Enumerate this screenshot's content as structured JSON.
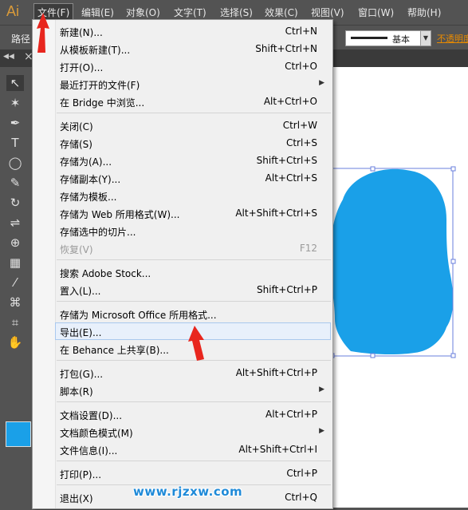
{
  "app": {
    "logo": "Ai"
  },
  "menubar": [
    "文件(F)",
    "编辑(E)",
    "对象(O)",
    "文字(T)",
    "选择(S)",
    "效果(C)",
    "视图(V)",
    "窗口(W)",
    "帮助(H)"
  ],
  "control_bar": {
    "label": "路径",
    "stroke_profile": "基本",
    "opacity": "不透明度"
  },
  "file_menu": {
    "items": [
      {
        "label": "新建(N)...",
        "shortcut": "Ctrl+N"
      },
      {
        "label": "从模板新建(T)...",
        "shortcut": "Shift+Ctrl+N"
      },
      {
        "label": "打开(O)...",
        "shortcut": "Ctrl+O"
      },
      {
        "label": "最近打开的文件(F)",
        "shortcut": ""
      },
      {
        "label": "在 Bridge 中浏览...",
        "shortcut": "Alt+Ctrl+O"
      },
      {
        "label": "关闭(C)",
        "shortcut": "Ctrl+W"
      },
      {
        "label": "存储(S)",
        "shortcut": "Ctrl+S"
      },
      {
        "label": "存储为(A)...",
        "shortcut": "Shift+Ctrl+S"
      },
      {
        "label": "存储副本(Y)...",
        "shortcut": "Alt+Ctrl+S"
      },
      {
        "label": "存储为模板...",
        "shortcut": ""
      },
      {
        "label": "存储为 Web 所用格式(W)...",
        "shortcut": "Alt+Shift+Ctrl+S"
      },
      {
        "label": "存储选中的切片...",
        "shortcut": ""
      },
      {
        "label": "恢复(V)",
        "shortcut": "F12"
      },
      {
        "label": "搜索 Adobe Stock...",
        "shortcut": ""
      },
      {
        "label": "置入(L)...",
        "shortcut": "Shift+Ctrl+P"
      },
      {
        "label": "存储为 Microsoft Office 所用格式...",
        "shortcut": ""
      },
      {
        "label": "导出(E)...",
        "shortcut": ""
      },
      {
        "label": "在 Behance 上共享(B)...",
        "shortcut": ""
      },
      {
        "label": "打包(G)...",
        "shortcut": "Alt+Shift+Ctrl+P"
      },
      {
        "label": "脚本(R)",
        "shortcut": ""
      },
      {
        "label": "文档设置(D)...",
        "shortcut": "Alt+Ctrl+P"
      },
      {
        "label": "文档颜色模式(M)",
        "shortcut": ""
      },
      {
        "label": "文件信息(I)...",
        "shortcut": "Alt+Shift+Ctrl+I"
      },
      {
        "label": "打印(P)...",
        "shortcut": "Ctrl+P"
      },
      {
        "label": "退出(X)",
        "shortcut": "Ctrl+Q"
      }
    ]
  },
  "artwork": {
    "fill_color": "#1aa0e8"
  },
  "watermark": "www.rjzxw.com"
}
